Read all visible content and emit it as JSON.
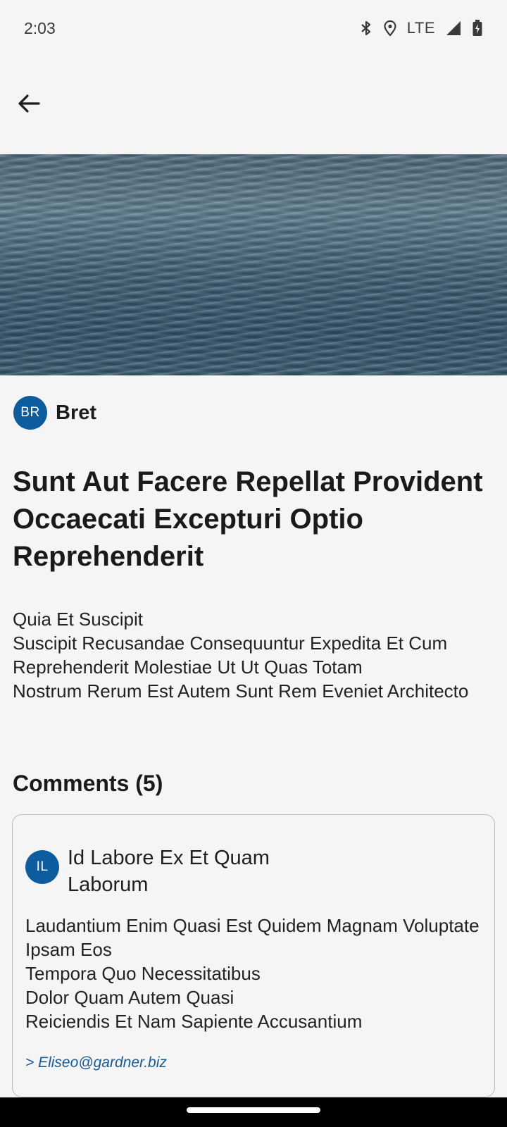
{
  "status_bar": {
    "time": "2:03",
    "network": "LTE",
    "icons": [
      "bluetooth-icon",
      "location-icon",
      "signal-icon",
      "battery-charging-icon"
    ]
  },
  "app_bar": {
    "back_icon": "arrow-left-icon"
  },
  "post": {
    "author_initials": "BR",
    "author_name": "Bret",
    "title": "Sunt Aut Facere Repellat Provident Occaecati Excepturi Optio Reprehenderit",
    "body": "Quia Et Suscipit\nSuscipit Recusandae Consequuntur Expedita Et Cum Reprehenderit Molestiae Ut Ut Quas Totam\nNostrum Rerum Est Autem Sunt Rem Eveniet Architecto"
  },
  "comments": {
    "heading": "Comments (5)",
    "items": [
      {
        "initials": "IL",
        "title": "Id Labore Ex Et Quam Laborum",
        "body": "Laudantium Enim Quasi Est Quidem Magnam Voluptate Ipsam Eos\nTempora Quo Necessitatibus\nDolor Quam Autem Quasi\nReiciendis Et Nam Sapiente Accusantium",
        "email": "> Eliseo@gardner.biz"
      }
    ]
  },
  "colors": {
    "accent": "#0d5c9e",
    "email": "#1a5a94",
    "background": "#f5f5f5"
  }
}
